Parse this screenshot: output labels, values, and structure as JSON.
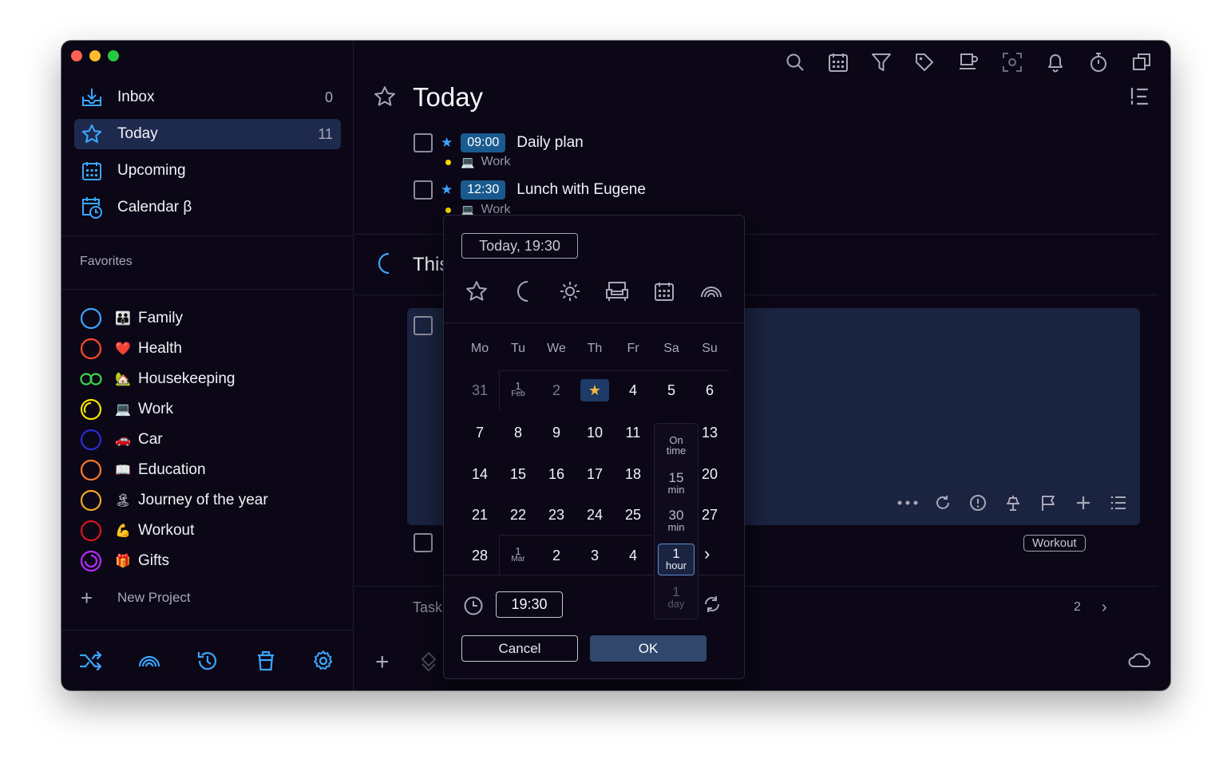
{
  "sidebar": {
    "nav": [
      {
        "label": "Inbox",
        "count": "0",
        "icon": "inbox-icon"
      },
      {
        "label": "Today",
        "count": "11",
        "icon": "star-icon"
      },
      {
        "label": "Upcoming",
        "count": "",
        "icon": "calendar-grid-icon"
      },
      {
        "label": "Calendar β",
        "count": "",
        "icon": "calendar-clock-icon"
      }
    ],
    "favorites_title": "Favorites",
    "projects": [
      {
        "label": "Family",
        "emoji": "👪",
        "color": "#3ba6ff"
      },
      {
        "label": "Health",
        "emoji": "❤️",
        "color": "#ff4b2b"
      },
      {
        "label": "Housekeeping",
        "emoji": "🏡",
        "color": "#3dd64a"
      },
      {
        "label": "Work",
        "emoji": "💻",
        "color": "#f5e400"
      },
      {
        "label": "Car",
        "emoji": "🚗",
        "color": "#2b2bd9"
      },
      {
        "label": "Education",
        "emoji": "📖",
        "color": "#ff7a2b"
      },
      {
        "label": "Journey of the year",
        "emoji": "🏝",
        "color": "#f5a623"
      },
      {
        "label": "Workout",
        "emoji": "💪",
        "color": "#d9151f"
      },
      {
        "label": "Gifts",
        "emoji": "🎁",
        "color": "#b62bff"
      }
    ],
    "new_project": "New Project"
  },
  "main": {
    "title": "Today",
    "tasks": [
      {
        "time": "09:00",
        "title": "Daily plan",
        "project": "Work"
      },
      {
        "time": "12:30",
        "title": "Lunch with Eugene",
        "project": "Work"
      }
    ],
    "section_title": "This",
    "tag": "Workout",
    "task_input": "Task",
    "page": "2"
  },
  "picker": {
    "date_value": "Today, 19:30",
    "weekdays": [
      "Mo",
      "Tu",
      "We",
      "Th",
      "Fr",
      "Sa",
      "Su"
    ],
    "weeks": [
      [
        "31",
        "1|Feb",
        "2",
        "★",
        "4",
        "5",
        "6"
      ],
      [
        "7",
        "8",
        "9",
        "10",
        "11",
        "",
        "13"
      ],
      [
        "14",
        "15",
        "16",
        "17",
        "18",
        "",
        "20"
      ],
      [
        "21",
        "22",
        "23",
        "24",
        "25",
        "",
        "27"
      ],
      [
        "28",
        "1|Mar",
        "2",
        "3",
        "4",
        "",
        ""
      ]
    ],
    "reminders": [
      {
        "big": "On",
        "small": "time"
      },
      {
        "big": "15",
        "small": "min"
      },
      {
        "big": "30",
        "small": "min"
      },
      {
        "big": "1",
        "small": "hour"
      },
      {
        "big": "1",
        "small": "day"
      }
    ],
    "time_value": "19:30",
    "cancel": "Cancel",
    "ok": "OK"
  },
  "colors": {
    "background": "#0b0716",
    "accent": "#3ba6ff",
    "active_nav": "#1e2a4d",
    "card": "#1a233f",
    "ok_button": "#31476b"
  }
}
